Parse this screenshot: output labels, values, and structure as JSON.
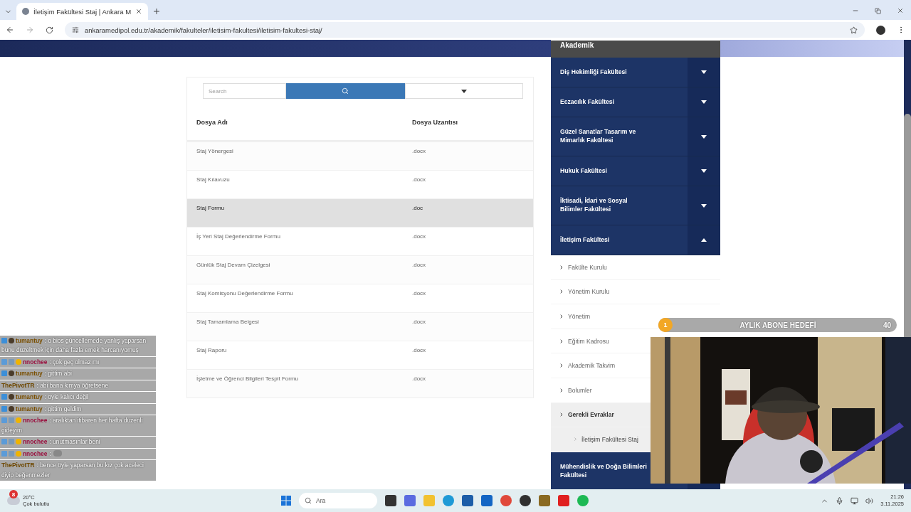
{
  "browser": {
    "tabs": [
      {
        "title": "İletişim Fakültesi Staj | Ankara M",
        "selected": true
      }
    ],
    "url": "ankaramedipol.edu.tr/akademik/fakulteler/iletisim-fakultesi/iletisim-fakultesi-staj/"
  },
  "file_table": {
    "search": {
      "placeholder": "Search"
    },
    "columns": [
      "Dosya Adı",
      "Dosya Uzantısı"
    ],
    "rows": [
      {
        "name": "Staj Yönergesi",
        "ext": ".docx",
        "hovered": false
      },
      {
        "name": "Staj Kılavuzu",
        "ext": ".docx",
        "hovered": false
      },
      {
        "name": "Staj Formu",
        "ext": ".doc",
        "hovered": true
      },
      {
        "name": "İş Yeri Staj Değerlendirme Formu",
        "ext": ".docx",
        "hovered": false
      },
      {
        "name": "Günlük Staj Devam Çizelgesi",
        "ext": ".docx",
        "hovered": false
      },
      {
        "name": "Staj Komisyonu Değerlendirme Formu",
        "ext": ".docx",
        "hovered": false
      },
      {
        "name": "Staj Tamamlama Belgesi",
        "ext": ".docx",
        "hovered": false
      },
      {
        "name": "Staj Raporu",
        "ext": ".docx",
        "hovered": false
      },
      {
        "name": "İşletme ve Öğrenci Bilgileri Tespit Formu",
        "ext": ".docx",
        "hovered": false
      }
    ]
  },
  "sidebar": {
    "header": "Akademik",
    "faculties": [
      {
        "name": "Diş Hekimliği Fakültesi",
        "expanded": false
      },
      {
        "name": "Eczacılık Fakültesi",
        "expanded": false
      },
      {
        "name": "Güzel Sanatlar Tasarım ve Mimarlık Fakültesi",
        "expanded": false
      },
      {
        "name": "Hukuk Fakültesi",
        "expanded": false
      },
      {
        "name": "İktisadi, İdari ve Sosyal Bilimler Fakültesi",
        "expanded": false
      },
      {
        "name": "İletişim Fakültesi",
        "expanded": true,
        "items": [
          {
            "label": "Fakülte Kurulu",
            "selected": false
          },
          {
            "label": "Yönetim Kurulu",
            "selected": false
          },
          {
            "label": "Yönetim",
            "selected": false
          },
          {
            "label": "Eğitim Kadrosu",
            "selected": false
          },
          {
            "label": "Akademik Takvim",
            "selected": false
          },
          {
            "label": "Bolumler",
            "selected": false
          },
          {
            "label": "Gerekli Evraklar",
            "selected": true,
            "children": [
              {
                "label": "İletişim Fakültesi Staj",
                "selected": true
              }
            ]
          }
        ]
      },
      {
        "name": "Mühendislik ve Doğa Bilimleri Fakültesi",
        "expanded": false
      }
    ]
  },
  "stream_overlay": {
    "chat": [
      {
        "kind": "vip",
        "user": "tumantuy",
        "color": "#7a4f00",
        "text": ": o bios güncellemede yanlış yaparsan bunu düzeltmek için daha fazla emek harcanıyomuş",
        "emote": false
      },
      {
        "kind": "subscriber",
        "user": "nnochee",
        "color": "#9a1240",
        "text": ": çok geç olmaz mı",
        "emote": false
      },
      {
        "kind": "vip",
        "user": "tumantuy",
        "color": "#7a4f00",
        "text": ": gittim abi",
        "emote": false
      },
      {
        "kind": "viewer",
        "user": "ThePivotTR",
        "color": "#6e4800",
        "text": ": abi bana kimya öğretsene",
        "emote": false
      },
      {
        "kind": "vip",
        "user": "tumantuy",
        "color": "#7a4f00",
        "text": ": öyle kalıcı değil",
        "emote": false
      },
      {
        "kind": "vip",
        "user": "tumantuy",
        "color": "#7a4f00",
        "text": ": gittim geldim",
        "emote": false
      },
      {
        "kind": "subscriber",
        "user": "nnochee",
        "color": "#9a1240",
        "text": ": aralıktan itibaren her hafta duzenli gideyim",
        "emote": false
      },
      {
        "kind": "subscriber",
        "user": "nnochee",
        "color": "#9a1240",
        "text": ": unutmasınlar beni",
        "emote": false
      },
      {
        "kind": "subscriber",
        "user": "nnochee",
        "color": "#9a1240",
        "text": ":",
        "emote": true
      },
      {
        "kind": "viewer",
        "user": "ThePivotTR",
        "color": "#6e4800",
        "text": ": bence öyle yaparsan bu kız çok aceleci diyip beğenmezler",
        "emote": false
      }
    ],
    "goal": {
      "current": "1",
      "title": "AYLIK ABONE HEDEFİ",
      "target": "40",
      "level": 0.03
    }
  },
  "taskbar": {
    "weather": {
      "badge": "8",
      "temperature": "20°C",
      "condition": "Çok bulutlu"
    },
    "search_placeholder": "Ara",
    "time": "21:26",
    "date": "3.11.2025"
  }
}
